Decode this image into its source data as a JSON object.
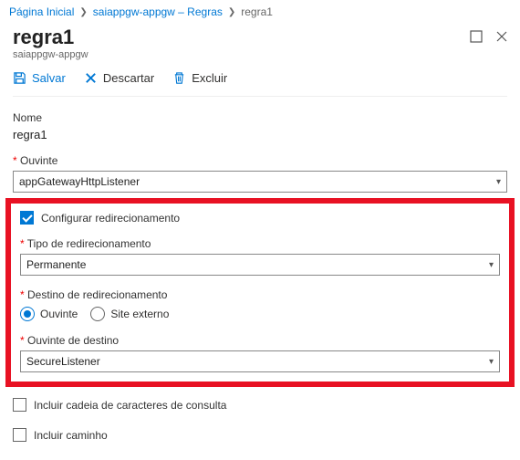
{
  "breadcrumb": {
    "items": [
      "Página Inicial",
      "saiappgw-appgw – Regras",
      "regra1"
    ]
  },
  "header": {
    "title": "regra1",
    "subtitle": "saiappgw-appgw"
  },
  "toolbar": {
    "save": "Salvar",
    "discard": "Descartar",
    "delete": "Excluir"
  },
  "form": {
    "name_label": "Nome",
    "name_value": "regra1",
    "listener_label": "Ouvinte",
    "listener_value": "appGatewayHttpListener",
    "configure_redirect": "Configurar redirecionamento",
    "redirect_type_label": "Tipo de redirecionamento",
    "redirect_type_value": "Permanente",
    "redirect_dest_label": "Destino de redirecionamento",
    "radio_listener": "Ouvinte",
    "radio_external": "Site externo",
    "dest_listener_label": "Ouvinte de destino",
    "dest_listener_value": "SecureListener",
    "include_query": "Incluir cadeia de caracteres de consulta",
    "include_path": "Incluir caminho"
  }
}
